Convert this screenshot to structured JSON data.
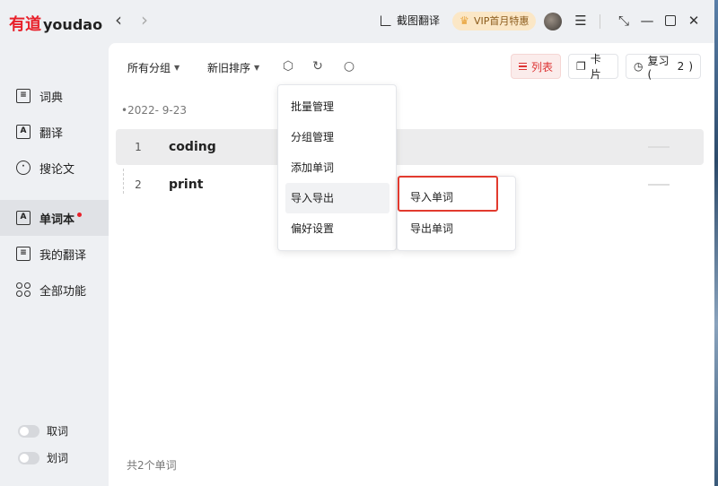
{
  "app": {
    "logo_mark": "有道",
    "logo_text": "youdao"
  },
  "titlebar": {
    "back_icon": "chevron-left-icon",
    "forward_icon": "chevron-right-icon",
    "screenshot_translate": "截图翻译",
    "vip_label": "VIP首月特惠",
    "icons": [
      "menu-icon",
      "pin-icon",
      "minimize-icon",
      "maximize-icon",
      "close-icon"
    ]
  },
  "sidebar": {
    "items": [
      {
        "label": "词典",
        "icon": "dictionary-icon"
      },
      {
        "label": "翻译",
        "icon": "translate-icon"
      },
      {
        "label": "搜论文",
        "icon": "search-paper-icon"
      },
      {
        "label": "单词本",
        "icon": "wordbook-icon",
        "active": true,
        "has_dot": true
      },
      {
        "label": "我的翻译",
        "icon": "my-translation-icon"
      },
      {
        "label": "全部功能",
        "icon": "all-features-icon"
      }
    ],
    "toggles": [
      {
        "label": "取词",
        "on": false
      },
      {
        "label": "划词",
        "on": false
      }
    ]
  },
  "toolbar": {
    "group_filter": "所有分组",
    "sort_order": "新旧排序",
    "list_label": "列表",
    "card_label": "卡片",
    "review_label": "复习(",
    "review_count": "2",
    "review_close": ")"
  },
  "wordlist": {
    "date": "2022- 9-23",
    "words": [
      {
        "num": "1",
        "word": "coding"
      },
      {
        "num": "2",
        "word": "print"
      }
    ],
    "total": "共2个单词"
  },
  "menu": {
    "items": [
      "批量管理",
      "分组管理",
      "添加单词",
      "导入导出",
      "偏好设置"
    ],
    "submenu": [
      "导入单词",
      "导出单词"
    ]
  },
  "colors": {
    "brand_red": "#e8202a",
    "highlight_frame": "#e23a2e",
    "vip_bg": "#fbe7c6"
  }
}
